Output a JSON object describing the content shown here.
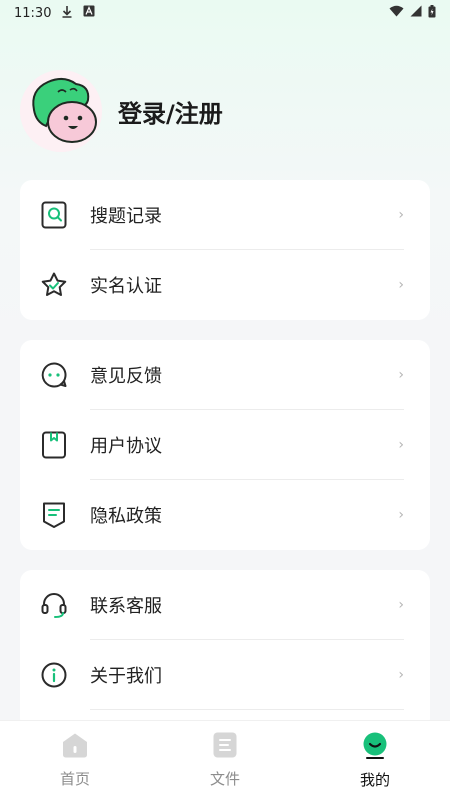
{
  "status_bar": {
    "time": "11:30",
    "icons": [
      "download-icon",
      "a-icon",
      "wifi-icon",
      "signal-icon",
      "battery-icon"
    ]
  },
  "profile": {
    "login_label": "登录/注册",
    "avatar_icon": "cartoon-avatar-icon"
  },
  "menu_groups": [
    {
      "items": [
        {
          "label": "搜题记录",
          "icon": "search-history-icon"
        },
        {
          "label": "实名认证",
          "icon": "verified-star-icon"
        }
      ]
    },
    {
      "items": [
        {
          "label": "意见反馈",
          "icon": "feedback-bubble-icon"
        },
        {
          "label": "用户协议",
          "icon": "bookmark-doc-icon"
        },
        {
          "label": "隐私政策",
          "icon": "policy-doc-icon"
        }
      ]
    },
    {
      "items": [
        {
          "label": "联系客服",
          "icon": "headset-icon"
        },
        {
          "label": "关于我们",
          "icon": "info-icon"
        }
      ]
    }
  ],
  "bottom_nav": {
    "items": [
      {
        "label": "首页",
        "icon": "home-icon",
        "active": false
      },
      {
        "label": "文件",
        "icon": "file-icon",
        "active": false
      },
      {
        "label": "我的",
        "icon": "profile-icon",
        "active": true
      }
    ]
  },
  "colors": {
    "accent": "#18c07a",
    "icon_stroke": "#2b2b2b",
    "inactive_nav": "#d6d6d6"
  }
}
